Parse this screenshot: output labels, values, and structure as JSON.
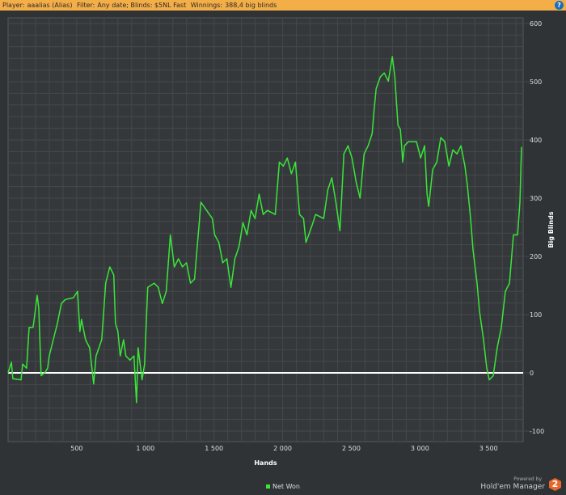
{
  "header": {
    "player_label": "Player:",
    "player": "aaalias (Alias)",
    "filter_label": "Filter:",
    "filter": "Any date; Blinds: $5NL Fast",
    "winnings_label": "Winnings:",
    "winnings": "388,4 big blinds",
    "help_icon": "?"
  },
  "branding": {
    "powered_by": "Powered by",
    "product": "Hold'em Manager",
    "logo_text": "2"
  },
  "chart_data": {
    "type": "line",
    "xlabel": "Hands",
    "ylabel": "Big Blinds",
    "xlim": [
      0,
      3740
    ],
    "ylim": [
      -120,
      610
    ],
    "xticks": [
      500,
      1000,
      1500,
      2000,
      2500,
      3000,
      3500
    ],
    "xtick_labels": [
      "500",
      "1 000",
      "1 500",
      "2 000",
      "2 500",
      "3 000",
      "3 500"
    ],
    "yticks": [
      -100,
      0,
      100,
      200,
      300,
      400,
      500,
      600
    ],
    "ytick_labels": [
      "-100",
      "0",
      "100",
      "200",
      "300",
      "400",
      "500",
      "600"
    ],
    "grid": true,
    "legend": "bottom-center",
    "series": [
      {
        "name": "Net Won",
        "color": "#39e639",
        "x": [
          0,
          24,
          35,
          94,
          106,
          135,
          153,
          182,
          194,
          212,
          223,
          241,
          270,
          288,
          300,
          329,
          359,
          388,
          417,
          476,
          506,
          523,
          535,
          564,
          594,
          623,
          641,
          682,
          711,
          741,
          770,
          782,
          800,
          817,
          841,
          858,
          888,
          917,
          935,
          947,
          976,
          994,
          1017,
          1064,
          1094,
          1123,
          1152,
          1182,
          1211,
          1241,
          1270,
          1300,
          1329,
          1358,
          1405,
          1446,
          1488,
          1505,
          1535,
          1564,
          1593,
          1623,
          1652,
          1682,
          1711,
          1740,
          1770,
          1799,
          1829,
          1858,
          1888,
          1946,
          1976,
          2005,
          2034,
          2064,
          2093,
          2123,
          2152,
          2170,
          2211,
          2240,
          2299,
          2329,
          2358,
          2388,
          2417,
          2446,
          2476,
          2505,
          2535,
          2564,
          2593,
          2623,
          2652,
          2664,
          2681,
          2711,
          2740,
          2770,
          2799,
          2817,
          2840,
          2858,
          2875,
          2887,
          2916,
          2975,
          3005,
          3034,
          3052,
          3064,
          3093,
          3123,
          3152,
          3181,
          3211,
          3240,
          3270,
          3299,
          3328,
          3346,
          3369,
          3387,
          3416,
          3434,
          3463,
          3487,
          3505,
          3534,
          3563,
          3593,
          3622,
          3652,
          3681,
          3711,
          3728,
          3740
        ],
        "y": [
          0,
          18,
          -10,
          -12,
          15,
          8,
          78,
          78,
          99,
          133,
          112,
          -5,
          1,
          8,
          29,
          57,
          85,
          119,
          126,
          129,
          140,
          71,
          92,
          57,
          43,
          -19,
          29,
          57,
          154,
          182,
          168,
          85,
          71,
          29,
          57,
          29,
          22,
          29,
          -51,
          43,
          -12,
          15,
          147,
          154,
          147,
          119,
          140,
          237,
          182,
          196,
          182,
          189,
          154,
          161,
          293,
          279,
          265,
          237,
          224,
          189,
          196,
          147,
          196,
          217,
          258,
          237,
          279,
          265,
          307,
          272,
          279,
          272,
          362,
          355,
          369,
          342,
          362,
          272,
          265,
          224,
          251,
          272,
          265,
          314,
          335,
          293,
          244,
          376,
          390,
          369,
          328,
          300,
          376,
          390,
          411,
          446,
          488,
          508,
          515,
          501,
          543,
          508,
          425,
          418,
          362,
          390,
          397,
          397,
          369,
          390,
          307,
          286,
          349,
          362,
          404,
          397,
          355,
          383,
          376,
          390,
          355,
          321,
          265,
          210,
          154,
          106,
          57,
          8,
          -12,
          -5,
          43,
          78,
          140,
          154,
          237,
          237,
          293,
          388
        ]
      }
    ],
    "zero_line_color": "#ffffff"
  }
}
